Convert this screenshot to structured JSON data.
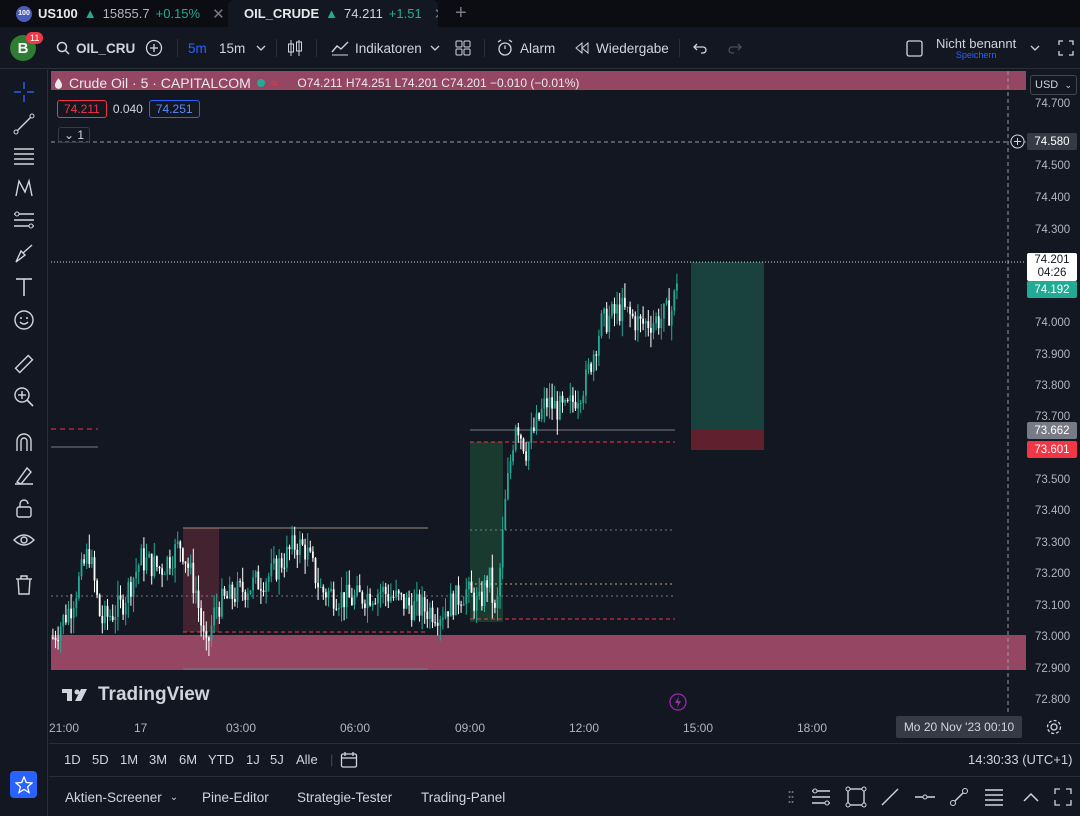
{
  "tabs": [
    {
      "badge": "100",
      "symbol": "US100",
      "arrow": "▲",
      "price": "15855.7",
      "change": "+0.15%"
    },
    {
      "symbol": "OIL_CRUDE",
      "arrow": "▲",
      "price": "74.211",
      "change": "+1.51"
    }
  ],
  "toolbar": {
    "avatar_letter": "B",
    "notifications": "11",
    "symbol_search": "OIL_CRU",
    "interval_5m": "5m",
    "interval_15m": "15m",
    "indicators": "Indikatoren",
    "alarm": "Alarm",
    "replay": "Wiedergabe",
    "layout_name": "Nicht benannt",
    "save": "Speichern"
  },
  "legend": {
    "title": "Crude Oil · 5 · CAPITALCOM",
    "ohlc": "O74.211 H74.251 L74.201 C74.201 −0.010 (−0.01%)",
    "bid": "74.211",
    "spread": "0.040",
    "ask": "74.251",
    "collapse_count": "1"
  },
  "price_axis": {
    "currency": "USD",
    "labels": [
      "74.700",
      "74.500",
      "74.400",
      "74.300",
      "74.000",
      "73.900",
      "73.800",
      "73.700",
      "73.500",
      "73.400",
      "73.300",
      "73.200",
      "73.100",
      "73.000",
      "72.900",
      "72.800"
    ],
    "crosshair_price": "74.580",
    "last_price": "74.201",
    "countdown": "04:26",
    "tag_green": "74.192",
    "tag_grey": "73.662",
    "tag_red": "73.601"
  },
  "time_axis": {
    "labels": [
      "21:00",
      "17",
      "03:00",
      "06:00",
      "09:00",
      "12:00",
      "15:00",
      "18:00"
    ],
    "crosshair_time": "Mo 20 Nov '23   00:10"
  },
  "ranges": [
    "1D",
    "5D",
    "1M",
    "3M",
    "6M",
    "YTD",
    "1J",
    "5J",
    "Alle"
  ],
  "clock": "14:30:33 (UTC+1)",
  "bottom_tabs": [
    "Aktien-Screener",
    "Pine-Editor",
    "Strategie-Tester",
    "Trading-Panel"
  ],
  "branding": "TradingView",
  "colors": {
    "background": "#131722",
    "up": "#22ab94",
    "down": "#ffffff",
    "zone": "#c2577a",
    "accent": "#2962ff",
    "red": "#f23645"
  }
}
